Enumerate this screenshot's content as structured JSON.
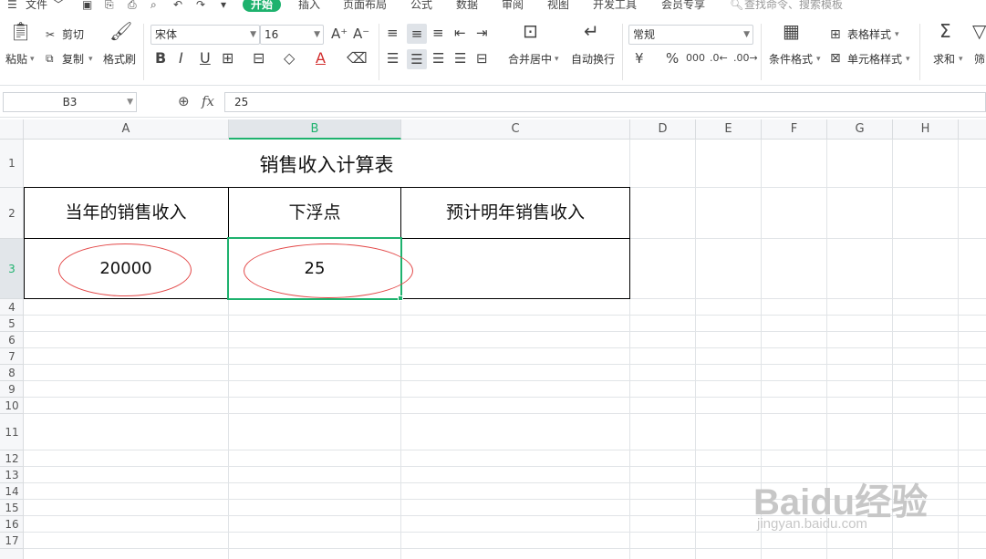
{
  "menubar": {
    "file_label": "文件",
    "tabs": [
      "开始",
      "插入",
      "页面布局",
      "公式",
      "数据",
      "审阅",
      "视图",
      "开发工具",
      "会员专享"
    ],
    "search_placeholder": "查找命令、搜索模板"
  },
  "toolbar": {
    "paste_label": "粘贴",
    "cut_label": "剪切",
    "copy_label": "复制",
    "format_painter_label": "格式刷",
    "font_name": "宋体",
    "font_size": "16",
    "merge_center_label": "合并居中",
    "wrap_text_label": "自动换行",
    "number_format": "常规",
    "conditional_format_label": "条件格式",
    "table_style_label": "表格样式",
    "cell_style_label": "单元格样式",
    "sum_label": "求和",
    "filter_label": "筛"
  },
  "formula_bar": {
    "name_box": "B3",
    "fx_label": "fx",
    "formula_value": "25"
  },
  "columns": [
    "A",
    "B",
    "C",
    "D",
    "E",
    "F",
    "G",
    "H"
  ],
  "rows": [
    "1",
    "2",
    "3",
    "4",
    "5",
    "6",
    "7",
    "8",
    "9",
    "10",
    "11",
    "12",
    "13",
    "14",
    "15",
    "16",
    "17"
  ],
  "sheet": {
    "title": "销售收入计算表",
    "headers": [
      "当年的销售收入",
      "下浮点",
      "预计明年销售收入"
    ],
    "values": [
      "20000",
      "25",
      ""
    ]
  },
  "selected_cell": "B3",
  "colors": {
    "accent": "#1eb26e",
    "annotation": "#e34848"
  },
  "watermark": {
    "brand": "Baidu经验",
    "url": "jingyan.baidu.com"
  }
}
